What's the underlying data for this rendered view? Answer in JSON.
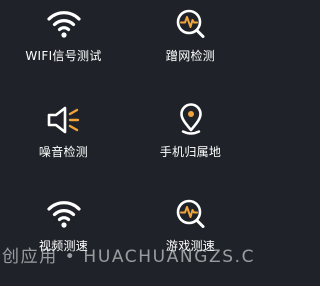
{
  "tools": {
    "wifi_test": {
      "label": "WIFI信号测试",
      "icon": "wifi-icon"
    },
    "freeloader_check": {
      "label": "蹭网检测",
      "icon": "pulse-search-icon"
    },
    "noise_check": {
      "label": "噪音检测",
      "icon": "speaker-icon"
    },
    "phone_location": {
      "label": "手机归属地",
      "icon": "location-pin-icon"
    },
    "video_speed": {
      "label": "视频测速",
      "icon": "wifi-icon"
    },
    "game_speed": {
      "label": "游戏测速",
      "icon": "pulse-search-icon"
    }
  },
  "watermark": {
    "text": "创应用 • HUACHUANGZS.COM"
  },
  "colors": {
    "background": "#1f2329",
    "icon": "#ffffff",
    "accent": "#f2a33a"
  }
}
